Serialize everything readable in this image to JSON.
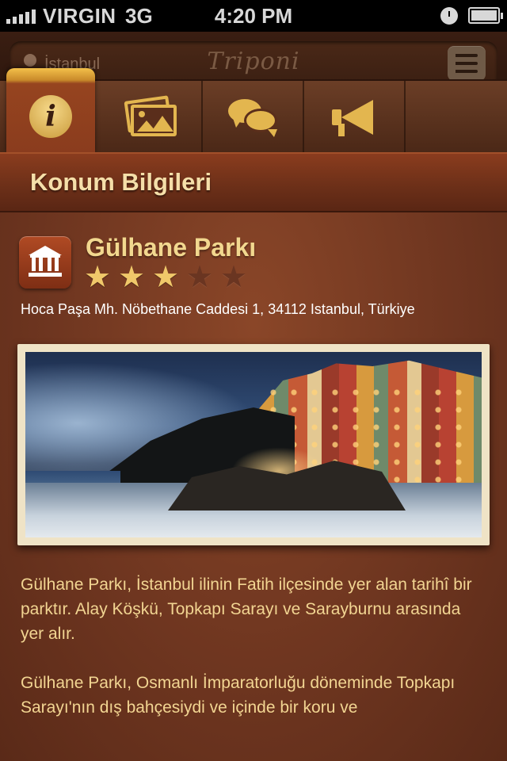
{
  "status_bar": {
    "carrier": "VIRGIN",
    "network": "3G",
    "time": "4:20 PM"
  },
  "nav": {
    "location": "İstanbul",
    "brand": "Triponi",
    "menu_icon": "list-menu-icon"
  },
  "tabs": [
    {
      "name": "info",
      "icon": "info-icon",
      "active": true
    },
    {
      "name": "photos",
      "icon": "photos-icon",
      "active": false
    },
    {
      "name": "comments",
      "icon": "chat-bubbles-icon",
      "active": false
    },
    {
      "name": "announcements",
      "icon": "megaphone-icon",
      "active": false
    }
  ],
  "section": {
    "title": "Konum Bilgileri"
  },
  "place": {
    "icon": "museum-icon",
    "name": "Gülhane Parkı",
    "rating": 3,
    "rating_max": 5,
    "address": "Hoca Paşa Mh. Nöbethane Caddesi 1, 34112 Istanbul, Türkiye"
  },
  "description": {
    "paragraph1": "Gülhane Parkı, İstanbul ilinin Fatih ilçesinde yer alan tarihî bir parktır. Alay Köşkü, Topkapı Sarayı ve Sarayburnu arasında yer alır.",
    "paragraph2": "Gülhane Parkı, Osmanlı İmparatorluğu döneminde Topkapı Sarayı'nın dış bahçesiydi ve içinde bir koru ve"
  },
  "colors": {
    "accent_gold": "#f2d88f",
    "header_red": "#8a3c1e",
    "background_brown": "#6f3620"
  }
}
